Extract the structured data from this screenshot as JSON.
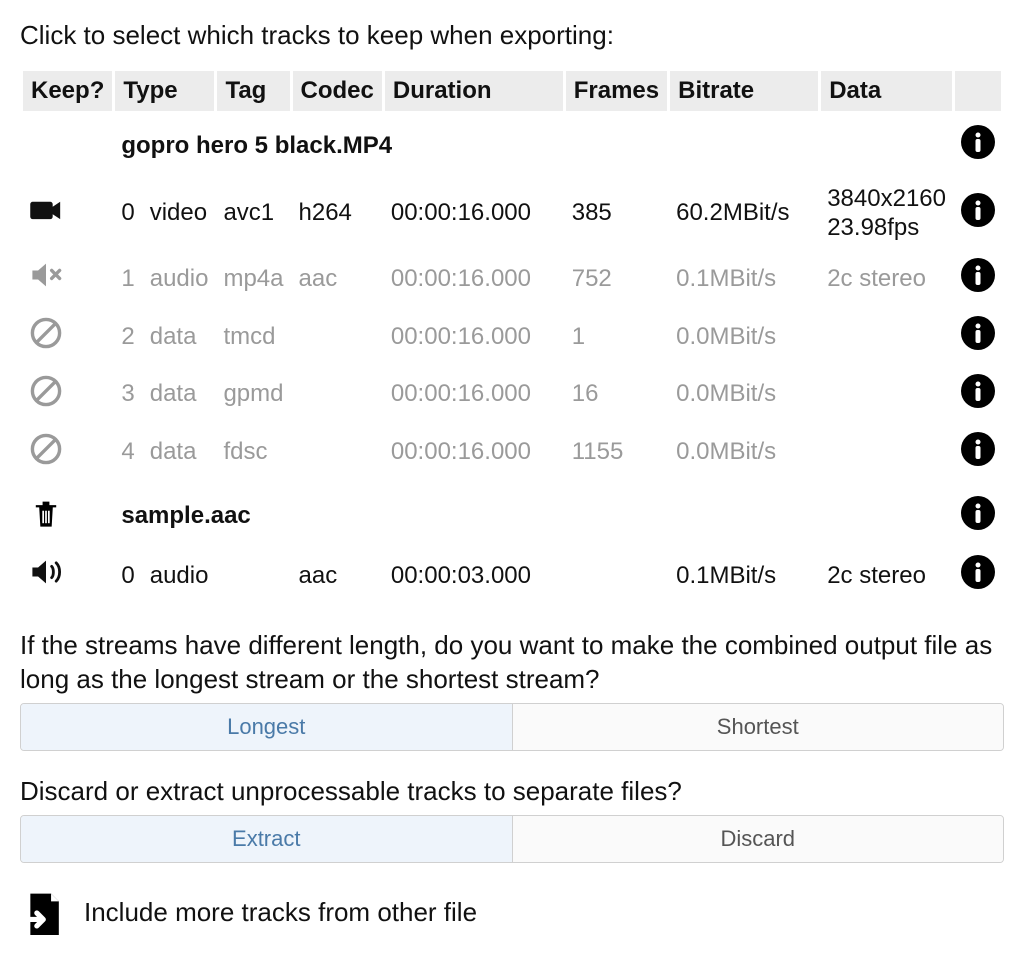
{
  "instruction": "Click to select which tracks to keep when exporting:",
  "headers": {
    "keep": "Keep?",
    "type": "Type",
    "tag": "Tag",
    "codec": "Codec",
    "duration": "Duration",
    "frames": "Frames",
    "bitrate": "Bitrate",
    "data": "Data"
  },
  "files": [
    {
      "name": "gopro hero 5 black.MP4",
      "file_icon": "none",
      "tracks": [
        {
          "icon": "video-on",
          "muted": false,
          "index": "0",
          "type": "video",
          "tag": "avc1",
          "codec": "h264",
          "duration": "00:00:16.000",
          "frames": "385",
          "bitrate": "60.2MBit/s",
          "data_line1": "3840x2160",
          "data_line2": "23.98fps"
        },
        {
          "icon": "audio-mute",
          "muted": true,
          "index": "1",
          "type": "audio",
          "tag": "mp4a",
          "codec": "aac",
          "duration": "00:00:16.000",
          "frames": "752",
          "bitrate": "0.1MBit/s",
          "data_line1": "2c stereo",
          "data_line2": ""
        },
        {
          "icon": "ban",
          "muted": true,
          "index": "2",
          "type": "data",
          "tag": "tmcd",
          "codec": "",
          "duration": "00:00:16.000",
          "frames": "1",
          "bitrate": "0.0MBit/s",
          "data_line1": "",
          "data_line2": ""
        },
        {
          "icon": "ban",
          "muted": true,
          "index": "3",
          "type": "data",
          "tag": "gpmd",
          "codec": "",
          "duration": "00:00:16.000",
          "frames": "16",
          "bitrate": "0.0MBit/s",
          "data_line1": "",
          "data_line2": ""
        },
        {
          "icon": "ban",
          "muted": true,
          "index": "4",
          "type": "data",
          "tag": "fdsc",
          "codec": "",
          "duration": "00:00:16.000",
          "frames": "1155",
          "bitrate": "0.0MBit/s",
          "data_line1": "",
          "data_line2": ""
        }
      ]
    },
    {
      "name": "sample.aac",
      "file_icon": "trash",
      "tracks": [
        {
          "icon": "audio-on",
          "muted": false,
          "index": "0",
          "type": "audio",
          "tag": "",
          "codec": "aac",
          "duration": "00:00:03.000",
          "frames": "",
          "bitrate": "0.1MBit/s",
          "data_line1": "2c stereo",
          "data_line2": ""
        }
      ]
    }
  ],
  "length_prompt": "If the streams have different length, do you want to make the combined output file as long as the longest stream or the shortest stream?",
  "length_options": {
    "longest": "Longest",
    "shortest": "Shortest",
    "selected": "longest"
  },
  "discard_prompt": "Discard or extract unprocessable tracks to separate files?",
  "discard_options": {
    "extract": "Extract",
    "discard": "Discard",
    "selected": "extract"
  },
  "include_more": "Include more tracks from other file"
}
